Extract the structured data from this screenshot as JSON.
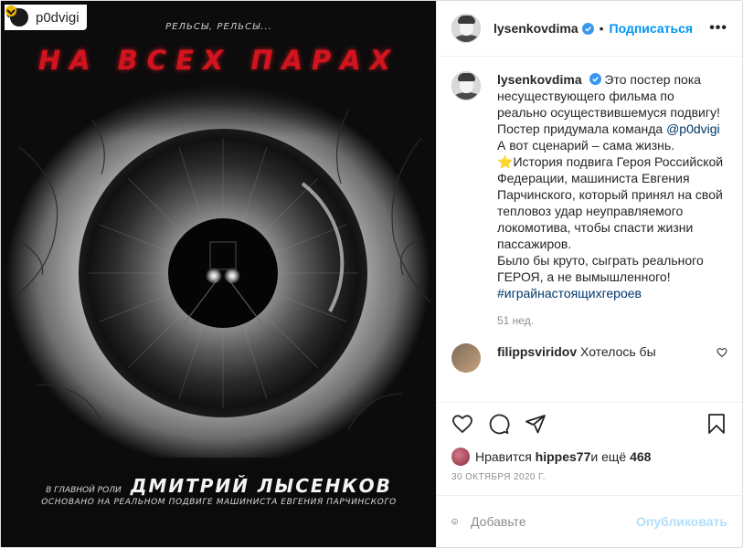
{
  "repost": {
    "username": "p0dvigi"
  },
  "poster": {
    "tagline": "РЕЛЬСЫ, РЕЛЬСЫ...",
    "title": "НА ВСЕХ ПАРАХ",
    "role_label": "В ГЛАВНОЙ РОЛИ",
    "actor": "ДМИТРИЙ ЛЫСЕНКОВ",
    "based_on": "ОСНОВАНО НА РЕАЛЬНОМ ПОДВИГЕ МАШИНИСТА ЕВГЕНИЯ ПАРЧИНСКОГО"
  },
  "header": {
    "username": "lysenkovdima",
    "dot": "•",
    "follow_label": "Подписаться",
    "more_label": "•••"
  },
  "caption": {
    "username": "lysenkovdima",
    "line1": "Это постер пока несуществующего фильма по реально осуществившемуся подвигу!",
    "line2": "Постер придумала команда ",
    "mention": "@p0dvigi",
    "line3": "А вот сценарий – сама жизнь.",
    "star": "⭐",
    "line4": "История подвига Героя Российской Федерации, машиниста Евгения Парчинского, который принял на свой тепловоз удар неуправляемого локомотива, чтобы спасти жизни пассажиров.",
    "line5": "Было бы круто, сыграть реального ГЕРОЯ, а не вымышленного!",
    "hashtag": "#играйнастоящихгероев",
    "time": "51 нед."
  },
  "comment2": {
    "username": "filippsviridov",
    "text": "Хотелось бы"
  },
  "likes": {
    "prefix": "Нравится ",
    "user": "hippes77",
    "middle": " и ещё ",
    "count": "468"
  },
  "date": "30 ОКТЯБРЯ 2020 Г.",
  "add_comment": {
    "placeholder": "Добавьте",
    "publish_label": "Опубликовать"
  },
  "colors": {
    "accent": "#0095f6",
    "publish_disabled": "#b2dffc",
    "title_red": "#d3141f"
  }
}
